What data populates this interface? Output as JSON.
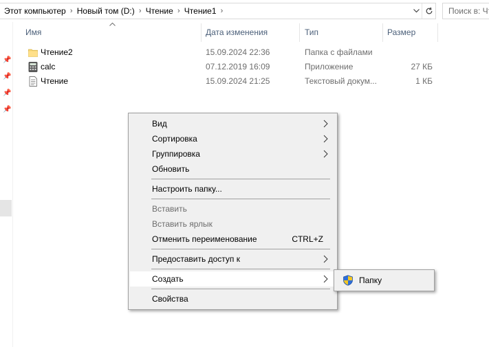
{
  "address_bar": {
    "crumbs": [
      "Этот компьютер",
      "Новый том (D:)",
      "Чтение",
      "Чтение1"
    ],
    "separator": "›"
  },
  "search": {
    "placeholder": "Поиск в: Чт"
  },
  "columns": {
    "name": "Имя",
    "date": "Дата изменения",
    "type": "Тип",
    "size": "Размер"
  },
  "files": [
    {
      "name": "Чтение2",
      "date": "15.09.2024 22:36",
      "type": "Папка с файлами",
      "size": "",
      "icon": "folder-icon"
    },
    {
      "name": "calc",
      "date": "07.12.2019 16:09",
      "type": "Приложение",
      "size": "27 КБ",
      "icon": "calculator-app-icon"
    },
    {
      "name": "Чтение",
      "date": "15.09.2024 21:25",
      "type": "Текстовый докум...",
      "size": "1 КБ",
      "icon": "text-document-icon"
    }
  ],
  "context_menu": {
    "view": "Вид",
    "sort": "Сортировка",
    "group": "Группировка",
    "refresh": "Обновить",
    "customize": "Настроить папку...",
    "paste": "Вставить",
    "paste_shortcut": "Вставить ярлык",
    "undo_rename": "Отменить переименование",
    "undo_shortcut": "CTRL+Z",
    "give_access": "Предоставить доступ к",
    "create": "Создать",
    "properties": "Свойства"
  },
  "submenu": {
    "folder": "Папку",
    "icon": "uac-shield-icon"
  },
  "colors": {
    "header_text": "#4c607a",
    "secondary_text": "#6d6d6d",
    "menu_bg": "#f0f0f0",
    "menu_border": "#a0a0a0",
    "folder_yellow": "#f8d775"
  }
}
